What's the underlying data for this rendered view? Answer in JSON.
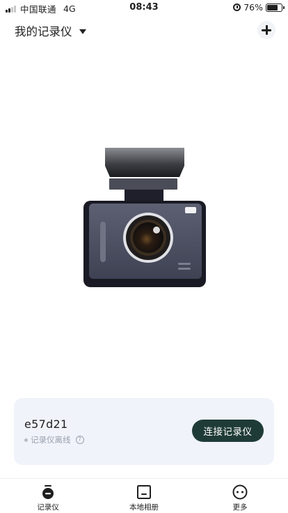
{
  "status_bar": {
    "carrier": "中国联通",
    "network": "4G",
    "time": "08:43",
    "battery": "76%",
    "battery_level": 0.76
  },
  "header": {
    "title": "我的记录仪"
  },
  "device": {
    "id": "e57d21",
    "status": "记录仪离线",
    "help_glyph": "?",
    "connect_label": "连接记录仪"
  },
  "tabs": [
    {
      "label": "记录仪",
      "icon": "dashcam-icon"
    },
    {
      "label": "本地相册",
      "icon": "album-icon"
    },
    {
      "label": "更多",
      "icon": "more-icon"
    }
  ],
  "colors": {
    "card_bg": "#f0f3f9",
    "connect_button": "#1f3b37",
    "camera_body": "#4a4f61",
    "offline_dot": "#b7bcc5"
  }
}
